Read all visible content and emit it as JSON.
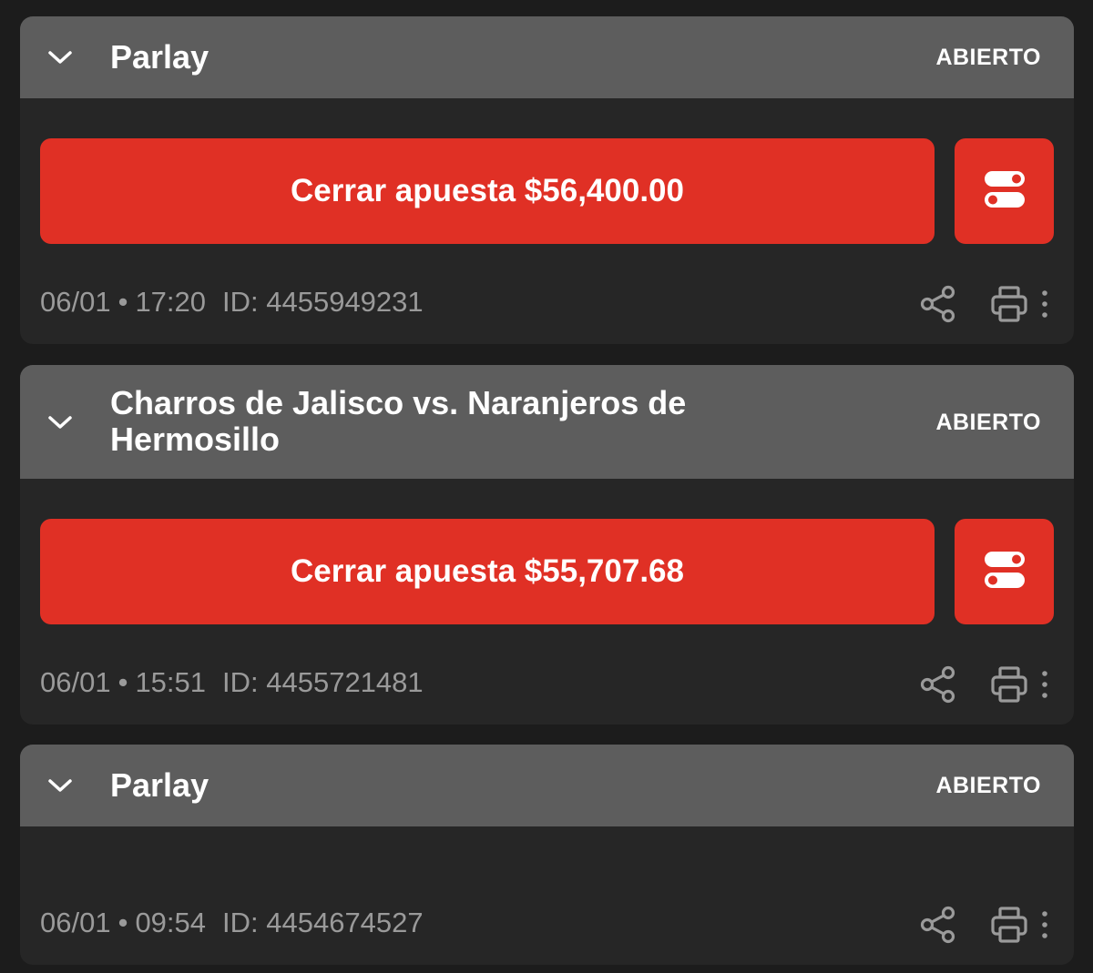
{
  "colors": {
    "accent": "#e03025",
    "header": "#5d5d5d",
    "card": "#262626",
    "background": "#1c1c1c",
    "meta_text": "#9a9a9a"
  },
  "bets": [
    {
      "title": "Parlay",
      "status": "ABIERTO",
      "cashout_label": "Cerrar apuesta $56,400.00",
      "date": "06/01",
      "separator": "•",
      "time": "17:20",
      "id_text": "ID: 4455949231"
    },
    {
      "title": "Charros de Jalisco vs. Naranjeros de Hermosillo",
      "status": "ABIERTO",
      "cashout_label": "Cerrar apuesta $55,707.68",
      "date": "06/01",
      "separator": "•",
      "time": "15:51",
      "id_text": "ID: 4455721481"
    },
    {
      "title": "Parlay",
      "status": "ABIERTO",
      "date": "06/01",
      "separator": "•",
      "time": "09:54",
      "id_text": "ID: 4454674527"
    }
  ],
  "icons": {
    "chevron": "chevron-down-icon",
    "toggle": "toggle-icon",
    "share": "share-icon",
    "print": "print-icon",
    "more": "more-vertical-icon"
  }
}
